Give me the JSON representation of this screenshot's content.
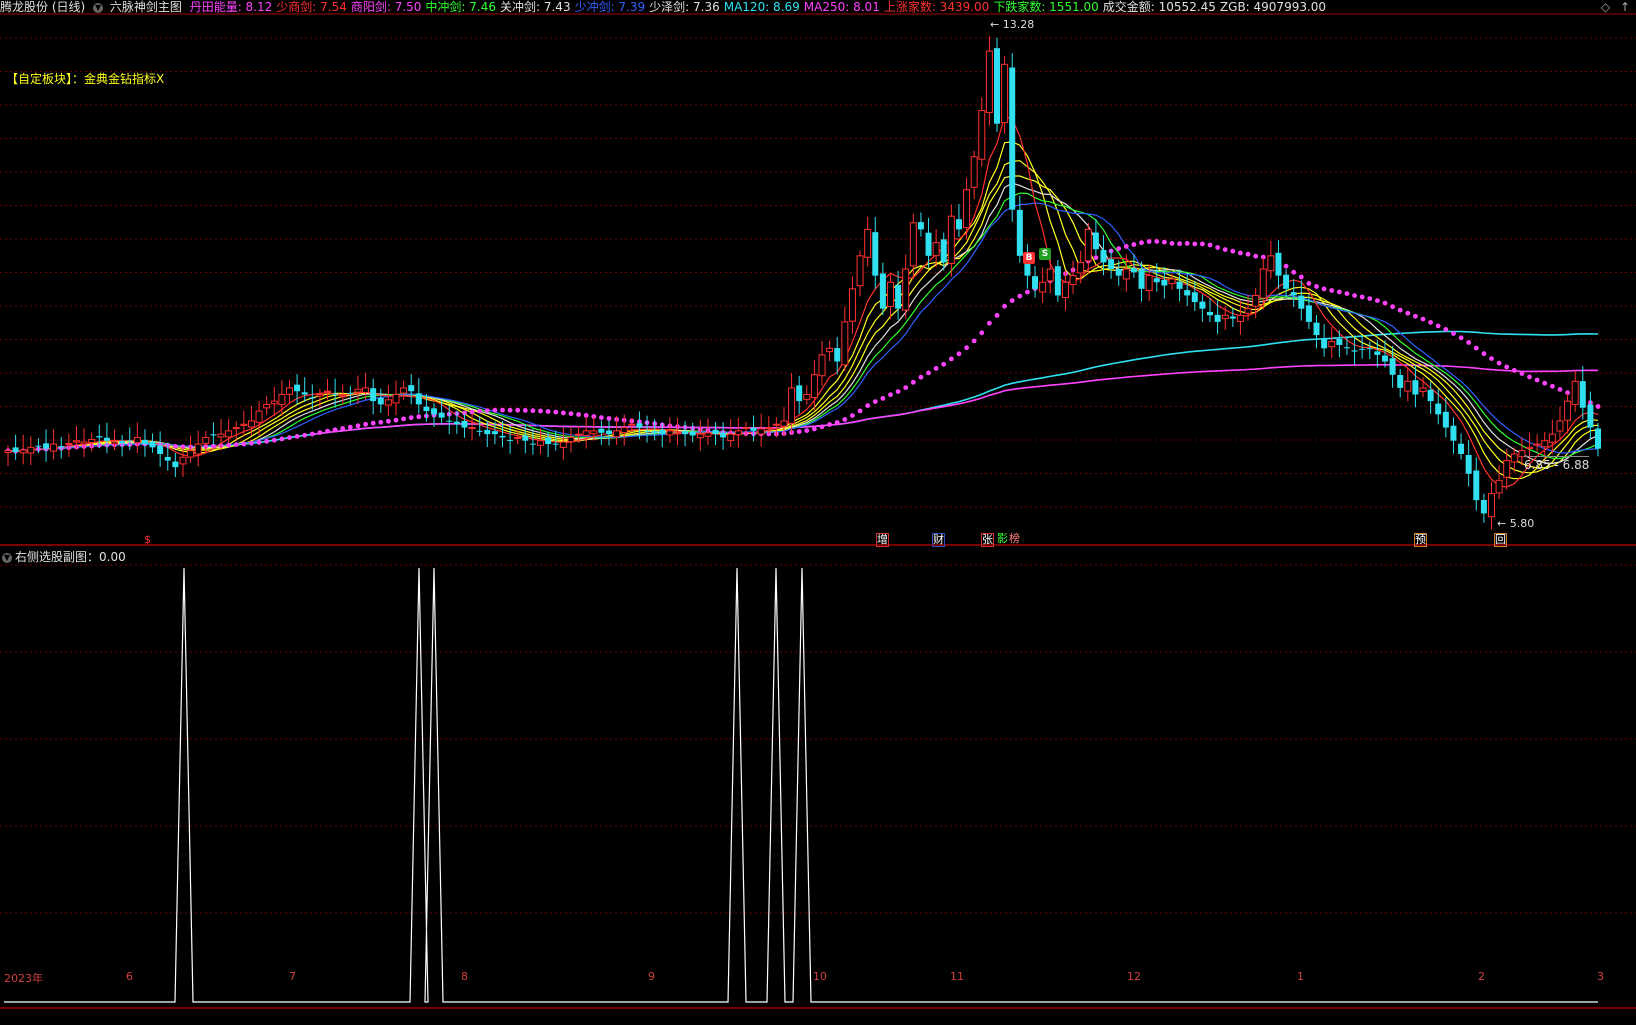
{
  "title_bar": {
    "stock": "腾龙股份 (日线)",
    "indicator": "六脉神剑主图",
    "values": [
      {
        "label": "丹田能量: ",
        "value": "8.12",
        "color": "#ff44ff"
      },
      {
        "label": "少商剑: ",
        "value": "7.54",
        "color": "#ff3030"
      },
      {
        "label": "商阳剑: ",
        "value": "7.50",
        "color": "#ff44ff"
      },
      {
        "label": "中冲剑: ",
        "value": "7.46",
        "color": "#30ff30"
      },
      {
        "label": "关冲剑: ",
        "value": "7.43",
        "color": "#e0e0e0"
      },
      {
        "label": "少冲剑: ",
        "value": "7.39",
        "color": "#3060ff"
      },
      {
        "label": "少泽剑: ",
        "value": "7.36",
        "color": "#e0e0e0"
      },
      {
        "label": "MA120: ",
        "value": "8.69",
        "color": "#30e0f0"
      },
      {
        "label": "MA250: ",
        "value": "8.01",
        "color": "#ff44ff"
      },
      {
        "label": "上涨家数: ",
        "value": "3439.00",
        "color": "#ff3030"
      },
      {
        "label": "下跌家数: ",
        "value": "1551.00",
        "color": "#30ff30"
      },
      {
        "label": "成交金额: ",
        "value": "10552.45",
        "color": "#e0e0e0"
      },
      {
        "label": "ZGB: ",
        "value": "4907993.00",
        "color": "#e0e0e0"
      }
    ],
    "corner_icons": [
      "◇",
      "↑"
    ]
  },
  "custom_block": "【自定板块】：金典金钻指标X",
  "price_labels": {
    "high": "13.28",
    "low": "5.80",
    "range": "6.85 - 6.88"
  },
  "event_marks": [
    {
      "text": "$",
      "color": "#ff3030"
    },
    {
      "text": "增",
      "color": "#ffffff"
    },
    {
      "text": "财",
      "color": "#ffffff"
    },
    {
      "text": "张",
      "color": "#ffffff"
    },
    {
      "text": "影",
      "color": "#30ff30"
    },
    {
      "text": "榜",
      "color": "#ff8080"
    },
    {
      "text": "预",
      "color": "#ffffff"
    },
    {
      "text": "回",
      "color": "#ffffff"
    }
  ],
  "signal_badges": [
    {
      "text": "B",
      "color": "#ff3030"
    },
    {
      "text": "S",
      "color": "#20a020"
    }
  ],
  "sub_panel": {
    "title": "右侧选股副图：0.00"
  },
  "time_axis": [
    "2023年",
    "6",
    "7",
    "8",
    "9",
    "10",
    "11",
    "12",
    "1",
    "2",
    "3"
  ],
  "colors": {
    "up": "#ff3030",
    "down": "#30e0f0",
    "grid": "#7a0000",
    "ma120": "#30e0f0",
    "ma250": "#ff44ff",
    "dots": "#ff44ff",
    "ribbon": "#ffff20"
  },
  "chart_data": {
    "type": "candlestick",
    "price_range": [
      5.8,
      13.28
    ],
    "closes": [
      6.85,
      6.83,
      6.86,
      6.9,
      6.92,
      6.88,
      6.95,
      6.9,
      6.96,
      7.0,
      6.98,
      7.02,
      7.05,
      7.0,
      6.98,
      6.96,
      7.0,
      7.05,
      6.95,
      6.9,
      6.8,
      6.7,
      6.6,
      6.75,
      6.85,
      6.95,
      7.05,
      7.08,
      7.1,
      7.15,
      7.2,
      7.25,
      7.3,
      7.45,
      7.55,
      7.6,
      7.7,
      7.8,
      7.75,
      7.7,
      7.65,
      7.7,
      7.75,
      7.7,
      7.68,
      7.72,
      7.78,
      7.8,
      7.6,
      7.55,
      7.62,
      7.7,
      7.8,
      7.75,
      7.55,
      7.45,
      7.4,
      7.35,
      7.3,
      7.25,
      7.2,
      7.2,
      7.15,
      7.1,
      7.1,
      7.05,
      7.0,
      7.05,
      7.0,
      6.95,
      7.0,
      6.95,
      6.95,
      6.98,
      7.05,
      7.1,
      7.15,
      7.15,
      7.12,
      7.1,
      7.15,
      7.2,
      7.25,
      7.2,
      7.15,
      7.12,
      7.1,
      7.15,
      7.12,
      7.1,
      7.08,
      7.1,
      7.12,
      7.1,
      7.05,
      7.1,
      7.15,
      7.2,
      7.15,
      7.18,
      7.2,
      7.25,
      7.3,
      7.8,
      7.6,
      7.7,
      8.0,
      8.3,
      8.4,
      8.2,
      8.8,
      9.3,
      9.8,
      10.2,
      9.5,
      9.0,
      9.4,
      9.0,
      9.6,
      10.3,
      10.2,
      9.8,
      10.0,
      9.7,
      10.4,
      10.2,
      10.8,
      11.3,
      12.0,
      12.9,
      11.8,
      12.7,
      10.5,
      9.8,
      9.5,
      9.3,
      9.4,
      9.6,
      9.2,
      9.4,
      9.5,
      9.7,
      10.2,
      9.9,
      9.7,
      9.6,
      9.5,
      9.6,
      9.55,
      9.3,
      9.5,
      9.4,
      9.35,
      9.45,
      9.3,
      9.2,
      9.1,
      9.0,
      8.9,
      8.8,
      8.9,
      8.85,
      8.9,
      9.0,
      9.2,
      9.6,
      9.8,
      9.5,
      9.3,
      9.2,
      9.0,
      8.8,
      8.6,
      8.4,
      8.5,
      8.45,
      8.4,
      8.35,
      8.38,
      8.4,
      8.3,
      8.2,
      8.0,
      7.8,
      7.9,
      7.7,
      7.8,
      7.6,
      7.4,
      7.2,
      7.0,
      6.8,
      6.5,
      6.1,
      5.9,
      6.2,
      6.4,
      6.7,
      6.8,
      6.85,
      6.9,
      6.95,
      7.0,
      7.1,
      7.3,
      7.6,
      7.9,
      7.5,
      7.2,
      6.88
    ]
  }
}
